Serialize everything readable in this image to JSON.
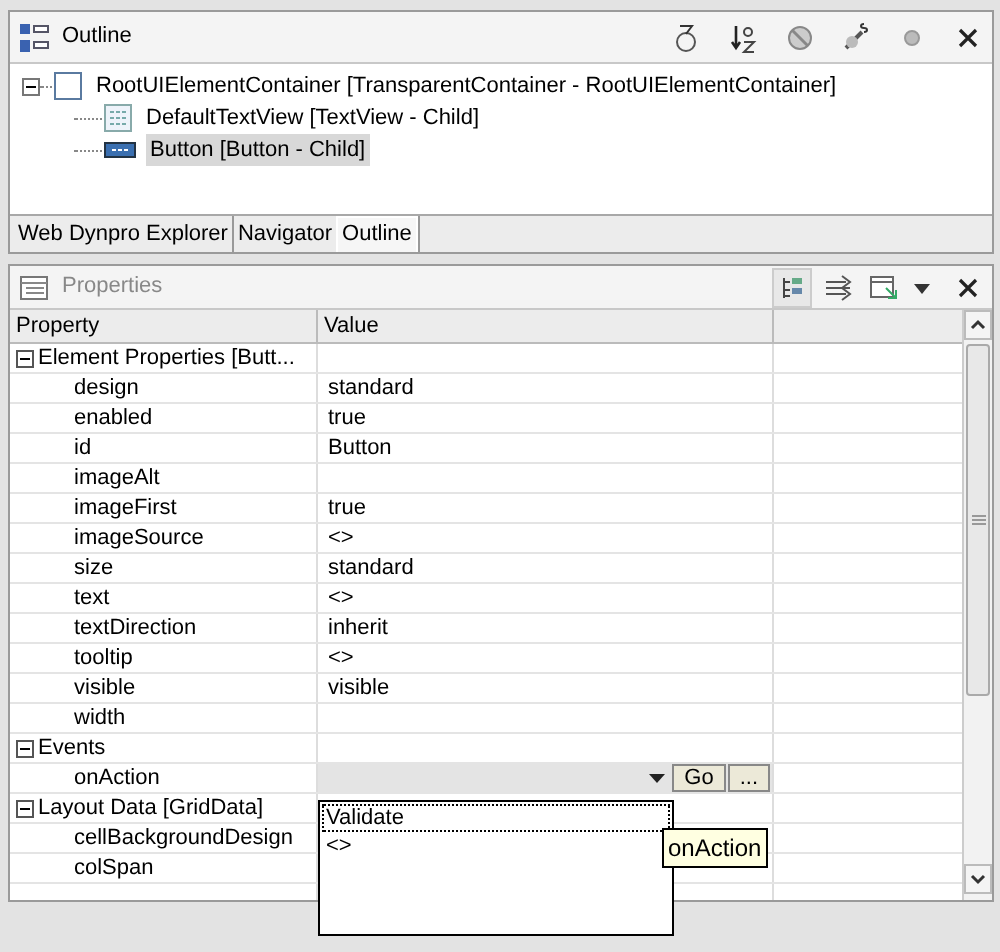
{
  "outline": {
    "title": "Outline",
    "tree": [
      {
        "label": "RootUIElementContainer [TransparentContainer - RootUIElementContainer]",
        "expanded": true,
        "selected": false,
        "children": [
          {
            "label": "DefaultTextView [TextView - Child]",
            "kind": "textview",
            "selected": false
          },
          {
            "label": "Button [Button - Child]",
            "kind": "button",
            "selected": true
          }
        ]
      }
    ],
    "tabs": [
      {
        "label": "Web Dynpro Explorer",
        "selected": false
      },
      {
        "label": "Navigator",
        "selected": false
      },
      {
        "label": "Outline",
        "selected": true
      }
    ]
  },
  "properties": {
    "title": "Properties",
    "columns": [
      "Property",
      "Value"
    ],
    "rows": [
      {
        "kind": "group",
        "label": "Element Properties [Butt...",
        "expanded": true
      },
      {
        "kind": "property",
        "name": "design",
        "value": "standard"
      },
      {
        "kind": "property",
        "name": "enabled",
        "value": "true"
      },
      {
        "kind": "property",
        "name": "id",
        "value": "Button"
      },
      {
        "kind": "property",
        "name": "imageAlt"
      },
      {
        "kind": "property",
        "name": "imageFirst",
        "value": "true"
      },
      {
        "kind": "property",
        "name": "imageSource",
        "value": "<>"
      },
      {
        "kind": "property",
        "name": "size",
        "value": "standard"
      },
      {
        "kind": "property",
        "name": "text",
        "value": "<>"
      },
      {
        "kind": "property",
        "name": "textDirection",
        "value": "inherit"
      },
      {
        "kind": "property",
        "name": "tooltip",
        "value": "<>"
      },
      {
        "kind": "property",
        "name": "visible",
        "value": "visible"
      },
      {
        "kind": "property",
        "name": "width"
      },
      {
        "kind": "group",
        "label": "Events",
        "expanded": true
      },
      {
        "kind": "combo",
        "name": "onAction",
        "buttons": [
          "Go",
          "..."
        ]
      },
      {
        "kind": "group",
        "label": "Layout Data [GridData]",
        "expanded": true
      },
      {
        "kind": "property",
        "name": "cellBackgroundDesign"
      },
      {
        "kind": "property",
        "name": "colSpan"
      },
      {
        "kind": "property"
      }
    ],
    "dropdown": {
      "items": [
        {
          "label": "Validate",
          "selected": true
        },
        {
          "label": "<>",
          "selected": false
        }
      ]
    },
    "tooltip": "onAction"
  }
}
